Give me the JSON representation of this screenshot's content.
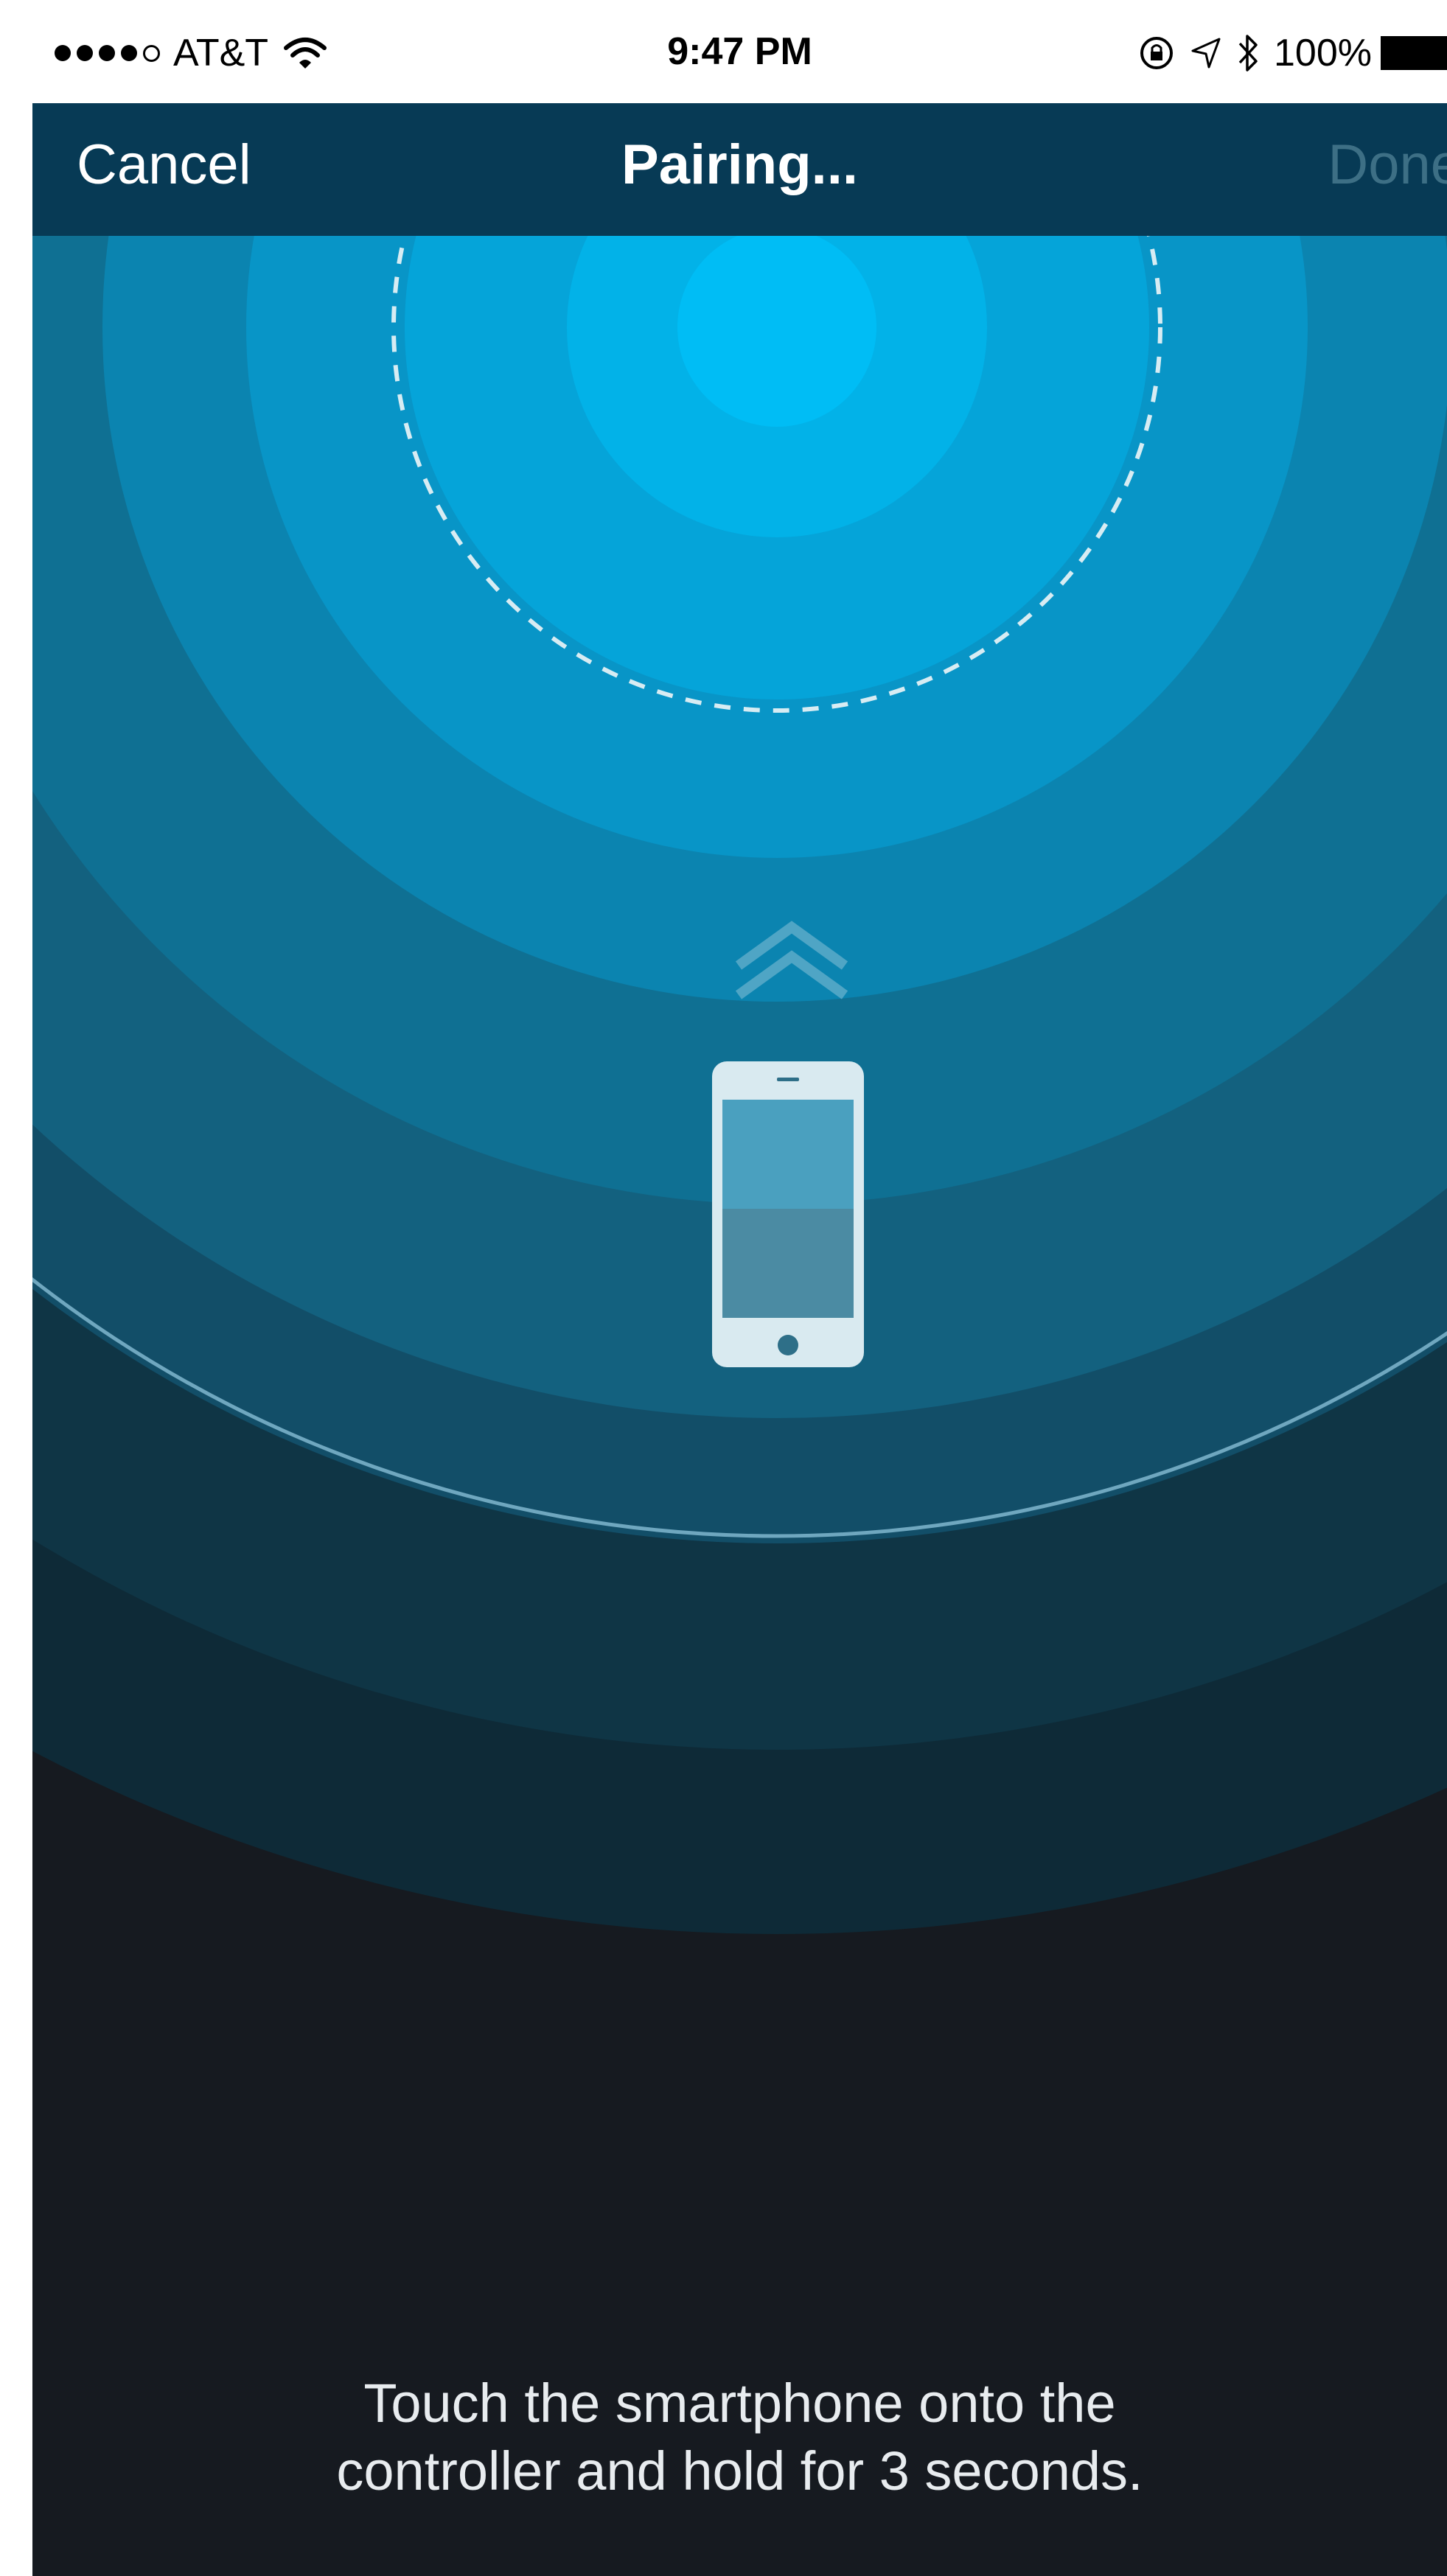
{
  "status_bar": {
    "carrier": "AT&T",
    "time": "9:47 PM",
    "battery": "100%",
    "icons": [
      "signal-dots-icon",
      "wifi-icon",
      "rotation-lock-icon",
      "location-arrow-icon",
      "bluetooth-icon",
      "battery-icon"
    ]
  },
  "nav": {
    "cancel_label": "Cancel",
    "title": "Pairing...",
    "done_label": "Done"
  },
  "illustration": {
    "icons": [
      "dashed-target-circle",
      "chevron-up-icon",
      "smartphone-icon"
    ],
    "colors": {
      "center": "#00bdf5",
      "ring_outer": "#0b3a4c",
      "background": "#161a20",
      "nav_bar": "#073a55"
    }
  },
  "instruction": {
    "line1": "Touch the smartphone onto the",
    "line2": "controller and hold for 3 seconds."
  }
}
